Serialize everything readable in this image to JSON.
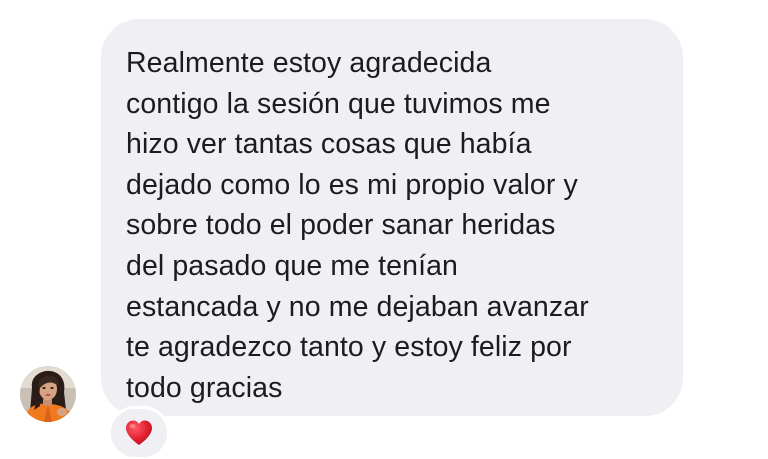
{
  "message": {
    "lines": [
      "Realmente estoy agradecida",
      "contigo la sesión que tuvimos me",
      "hizo ver tantas cosas que había",
      "dejado como lo es mi propio valor y",
      "sobre todo el poder sanar heridas",
      "del pasado que me tenían",
      "estancada y no me dejaban avanzar",
      "te agradezco tanto y estoy feliz por",
      "todo gracias"
    ]
  },
  "reaction": {
    "icon": "heart-icon",
    "color": "#e0202f"
  },
  "avatar": {
    "icon": "user-avatar"
  },
  "colors": {
    "bubble": "#efeff4",
    "text": "#1c1c1e",
    "background": "#ffffff"
  }
}
